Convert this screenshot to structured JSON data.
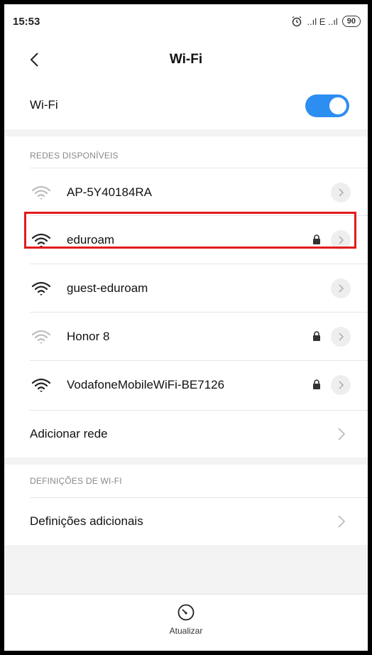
{
  "status_bar": {
    "time": "15:53",
    "signal_text": "..ıl E ..ıl",
    "battery": "90"
  },
  "header": {
    "title": "Wi-Fi"
  },
  "wifi_toggle": {
    "label": "Wi-Fi",
    "enabled": true,
    "accent": "#2d8ef2"
  },
  "available_networks": {
    "header": "REDES DISPONÍVEIS",
    "items": [
      {
        "name": "AP-5Y40184RA",
        "secured": false,
        "signal": "weak"
      },
      {
        "name": "eduroam",
        "secured": true,
        "signal": "strong",
        "highlighted": true
      },
      {
        "name": "guest-eduroam",
        "secured": false,
        "signal": "strong"
      },
      {
        "name": "Honor 8",
        "secured": true,
        "signal": "weak"
      },
      {
        "name": "VodafoneMobileWiFi-BE7126",
        "secured": true,
        "signal": "strong"
      }
    ],
    "add_network": "Adicionar rede"
  },
  "wifi_settings": {
    "header": "DEFINIÇÕES DE WI-FI",
    "additional": "Definições adicionais"
  },
  "bottom": {
    "refresh_label": "Atualizar"
  },
  "colors": {
    "highlight": "#e21b1b"
  }
}
